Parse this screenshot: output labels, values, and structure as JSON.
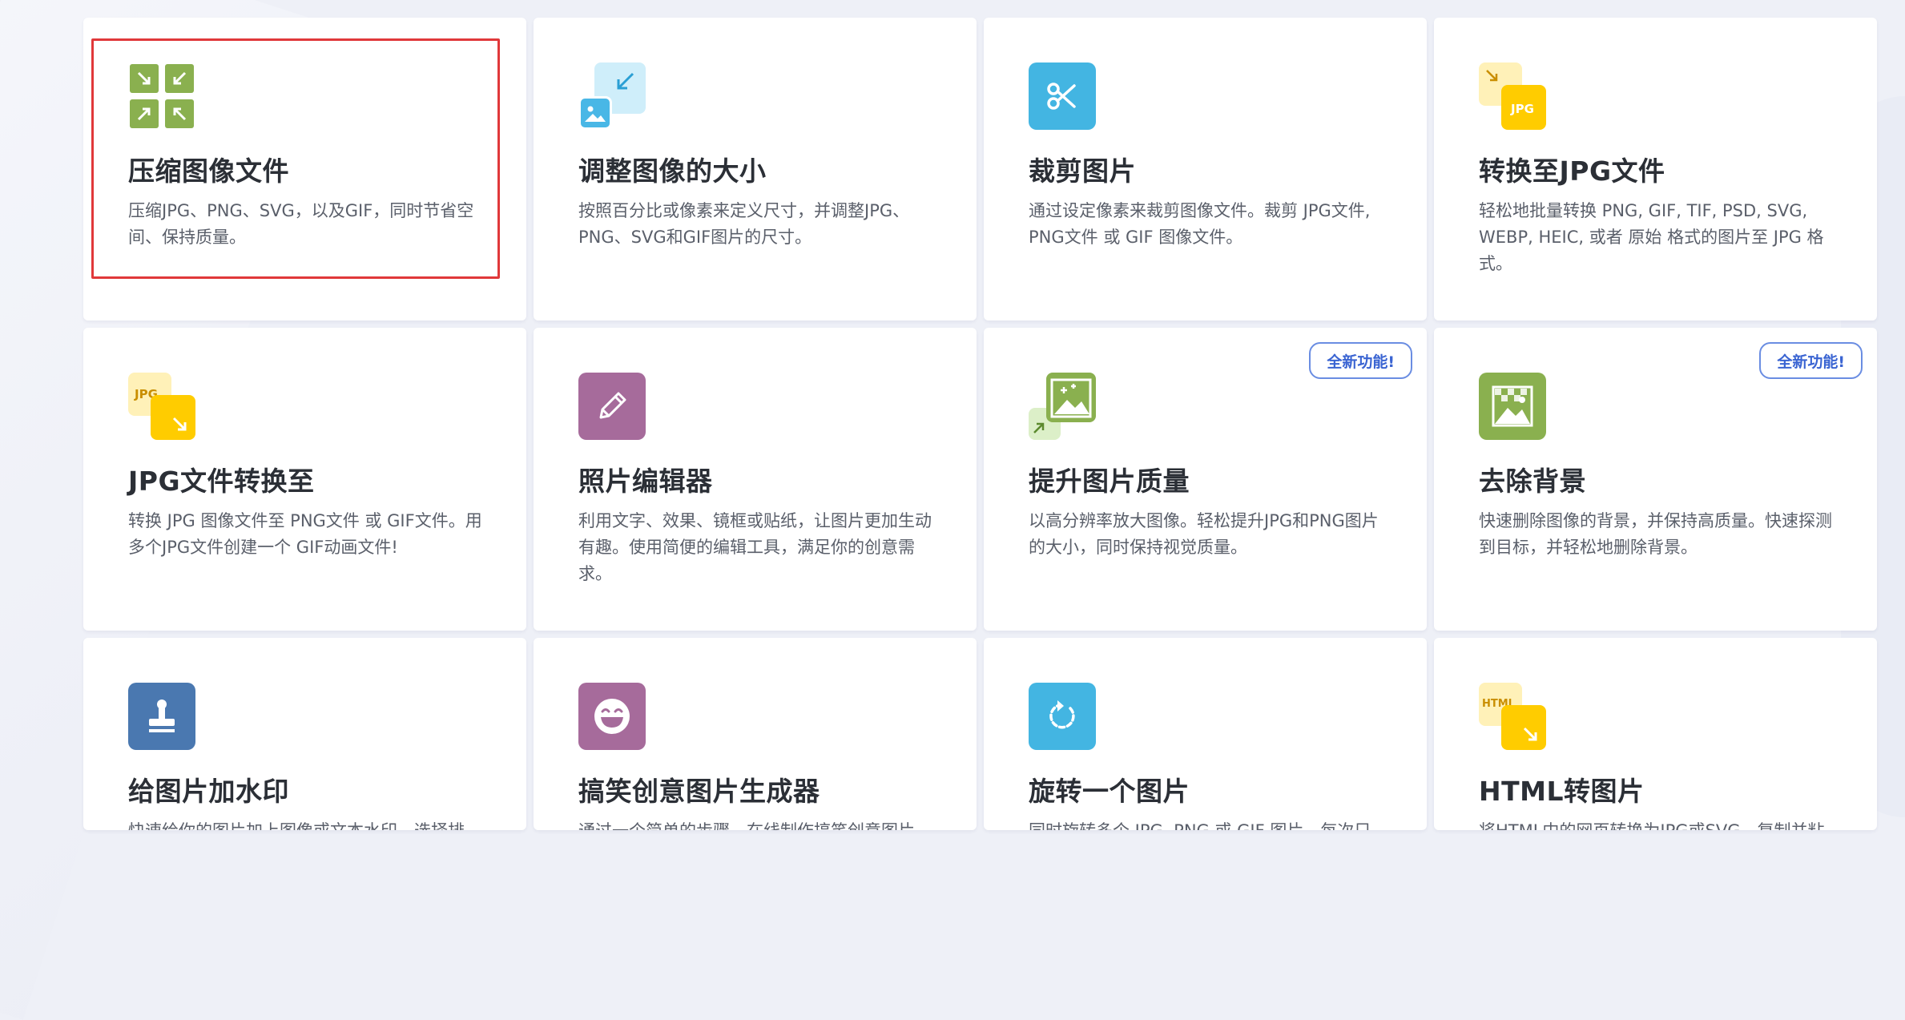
{
  "cards": [
    {
      "title": "压缩图像文件",
      "desc": "压缩JPG、PNG、SVG，以及GIF，同时节省空间、保持质量。",
      "icon": "compress-icon"
    },
    {
      "title": "调整图像的大小",
      "desc": "按照百分比或像素来定义尺寸，并调整JPG、PNG、SVG和GIF图片的尺寸。",
      "icon": "resize-icon"
    },
    {
      "title": "裁剪图片",
      "desc": "通过设定像素来裁剪图像文件。裁剪 JPG文件, PNG文件 或 GIF 图像文件。",
      "icon": "crop-scissors-icon"
    },
    {
      "title": "转换至JPG文件",
      "desc": "轻松地批量转换 PNG, GIF, TIF, PSD, SVG, WEBP, HEIC, 或者 原始 格式的图片至 JPG 格式。",
      "icon": "convert-to-jpg-icon",
      "icon_label": "JPG"
    },
    {
      "title": "JPG文件转换至",
      "desc": "转换 JPG 图像文件至 PNG文件 或 GIF文件。用多个JPG文件创建一个 GIF动画文件!",
      "icon": "convert-from-jpg-icon",
      "icon_label": "JPG"
    },
    {
      "title": "照片编辑器",
      "desc": "利用文字、效果、镜框或贴纸，让图片更加生动有趣。使用简便的编辑工具，满足你的创意需求。",
      "icon": "pencil-icon"
    },
    {
      "title": "提升图片质量",
      "desc": "以高分辨率放大图像。轻松提升JPG和PNG图片的大小，同时保持视觉质量。",
      "icon": "upscale-image-icon",
      "badge": "全新功能!"
    },
    {
      "title": "去除背景",
      "desc": "快速删除图像的背景，并保持高质量。快速探测到目标，并轻松地删除背景。",
      "icon": "remove-background-icon",
      "badge": "全新功能!"
    },
    {
      "title": "给图片加水印",
      "desc": "快速给你的图片加上图像或文本水印。选择排版、透明度和位置。",
      "icon": "stamp-icon"
    },
    {
      "title": "搞笑创意图片生成器",
      "desc": "通过一个简单的步骤，在线制作搞笑创意图片。选择你自己的模板，或者从最流行的模板中选择。",
      "icon": "laughing-face-icon"
    },
    {
      "title": "旋转一个图片",
      "desc": "同时旋转多个 JPG, PNG 或 GIF 图片。每次只选择横向或纵向图片!",
      "icon": "rotate-icon"
    },
    {
      "title": "HTML转图片",
      "desc": "将HTML中的网页转换为JPG或SVG。复制并粘贴网页的URL链接，然后单击，将其转换为图片。",
      "icon": "html-to-image-icon",
      "icon_label": "HTML"
    }
  ],
  "colors": {
    "compress": "#8ab04f",
    "resize": "#49b7e6",
    "crop": "#43b5e2",
    "jpg": "#ffcc00",
    "editor": "#a66b9b",
    "upscale": "#8ab04f",
    "remove_bg": "#8ab04f",
    "watermark": "#4a78b0",
    "meme": "#a66b9b",
    "rotate": "#43b5e2",
    "badge": "#3a64d2",
    "highlight": "#e0383a"
  }
}
